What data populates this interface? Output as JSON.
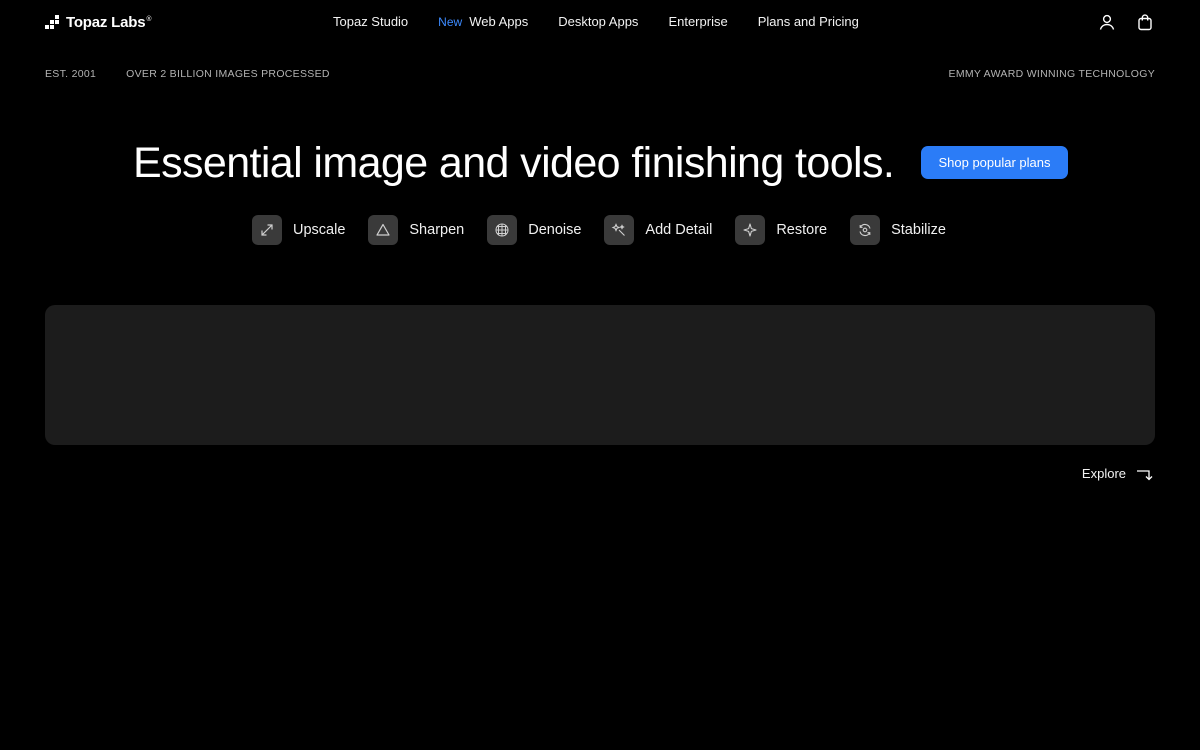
{
  "brand": {
    "name": "Topaz Labs",
    "reg": "®"
  },
  "nav": {
    "items": [
      {
        "label": "Topaz Studio",
        "badge": ""
      },
      {
        "label": "Web Apps",
        "badge": "New"
      },
      {
        "label": "Desktop Apps",
        "badge": ""
      },
      {
        "label": "Enterprise",
        "badge": ""
      },
      {
        "label": "Plans and Pricing",
        "badge": ""
      }
    ],
    "icons": [
      "user-icon",
      "shopping-bag-icon"
    ]
  },
  "info": {
    "established": "EST. 2001",
    "processed": "OVER 2 BILLION IMAGES PROCESSED",
    "award": "EMMY AWARD WINNING TECHNOLOGY"
  },
  "hero": {
    "title": "Essential image and video finishing tools.",
    "cta": "Shop popular plans"
  },
  "features": [
    {
      "label": "Upscale",
      "icon": "upscale-arrows-icon"
    },
    {
      "label": "Sharpen",
      "icon": "triangle-icon"
    },
    {
      "label": "Denoise",
      "icon": "grain-globe-icon"
    },
    {
      "label": "Add Detail",
      "icon": "sparkle-wand-icon"
    },
    {
      "label": "Restore",
      "icon": "sparkle-icon"
    },
    {
      "label": "Stabilize",
      "icon": "stabilize-icon"
    }
  ],
  "explore": {
    "label": "Explore"
  },
  "colors": {
    "background": "#000000",
    "accent": "#2b7cf7",
    "new_badge": "#3d8bff",
    "panel": "#1c1c1c",
    "icon_tile": "#3a3a3a",
    "muted_text": "#b3b3b3"
  }
}
